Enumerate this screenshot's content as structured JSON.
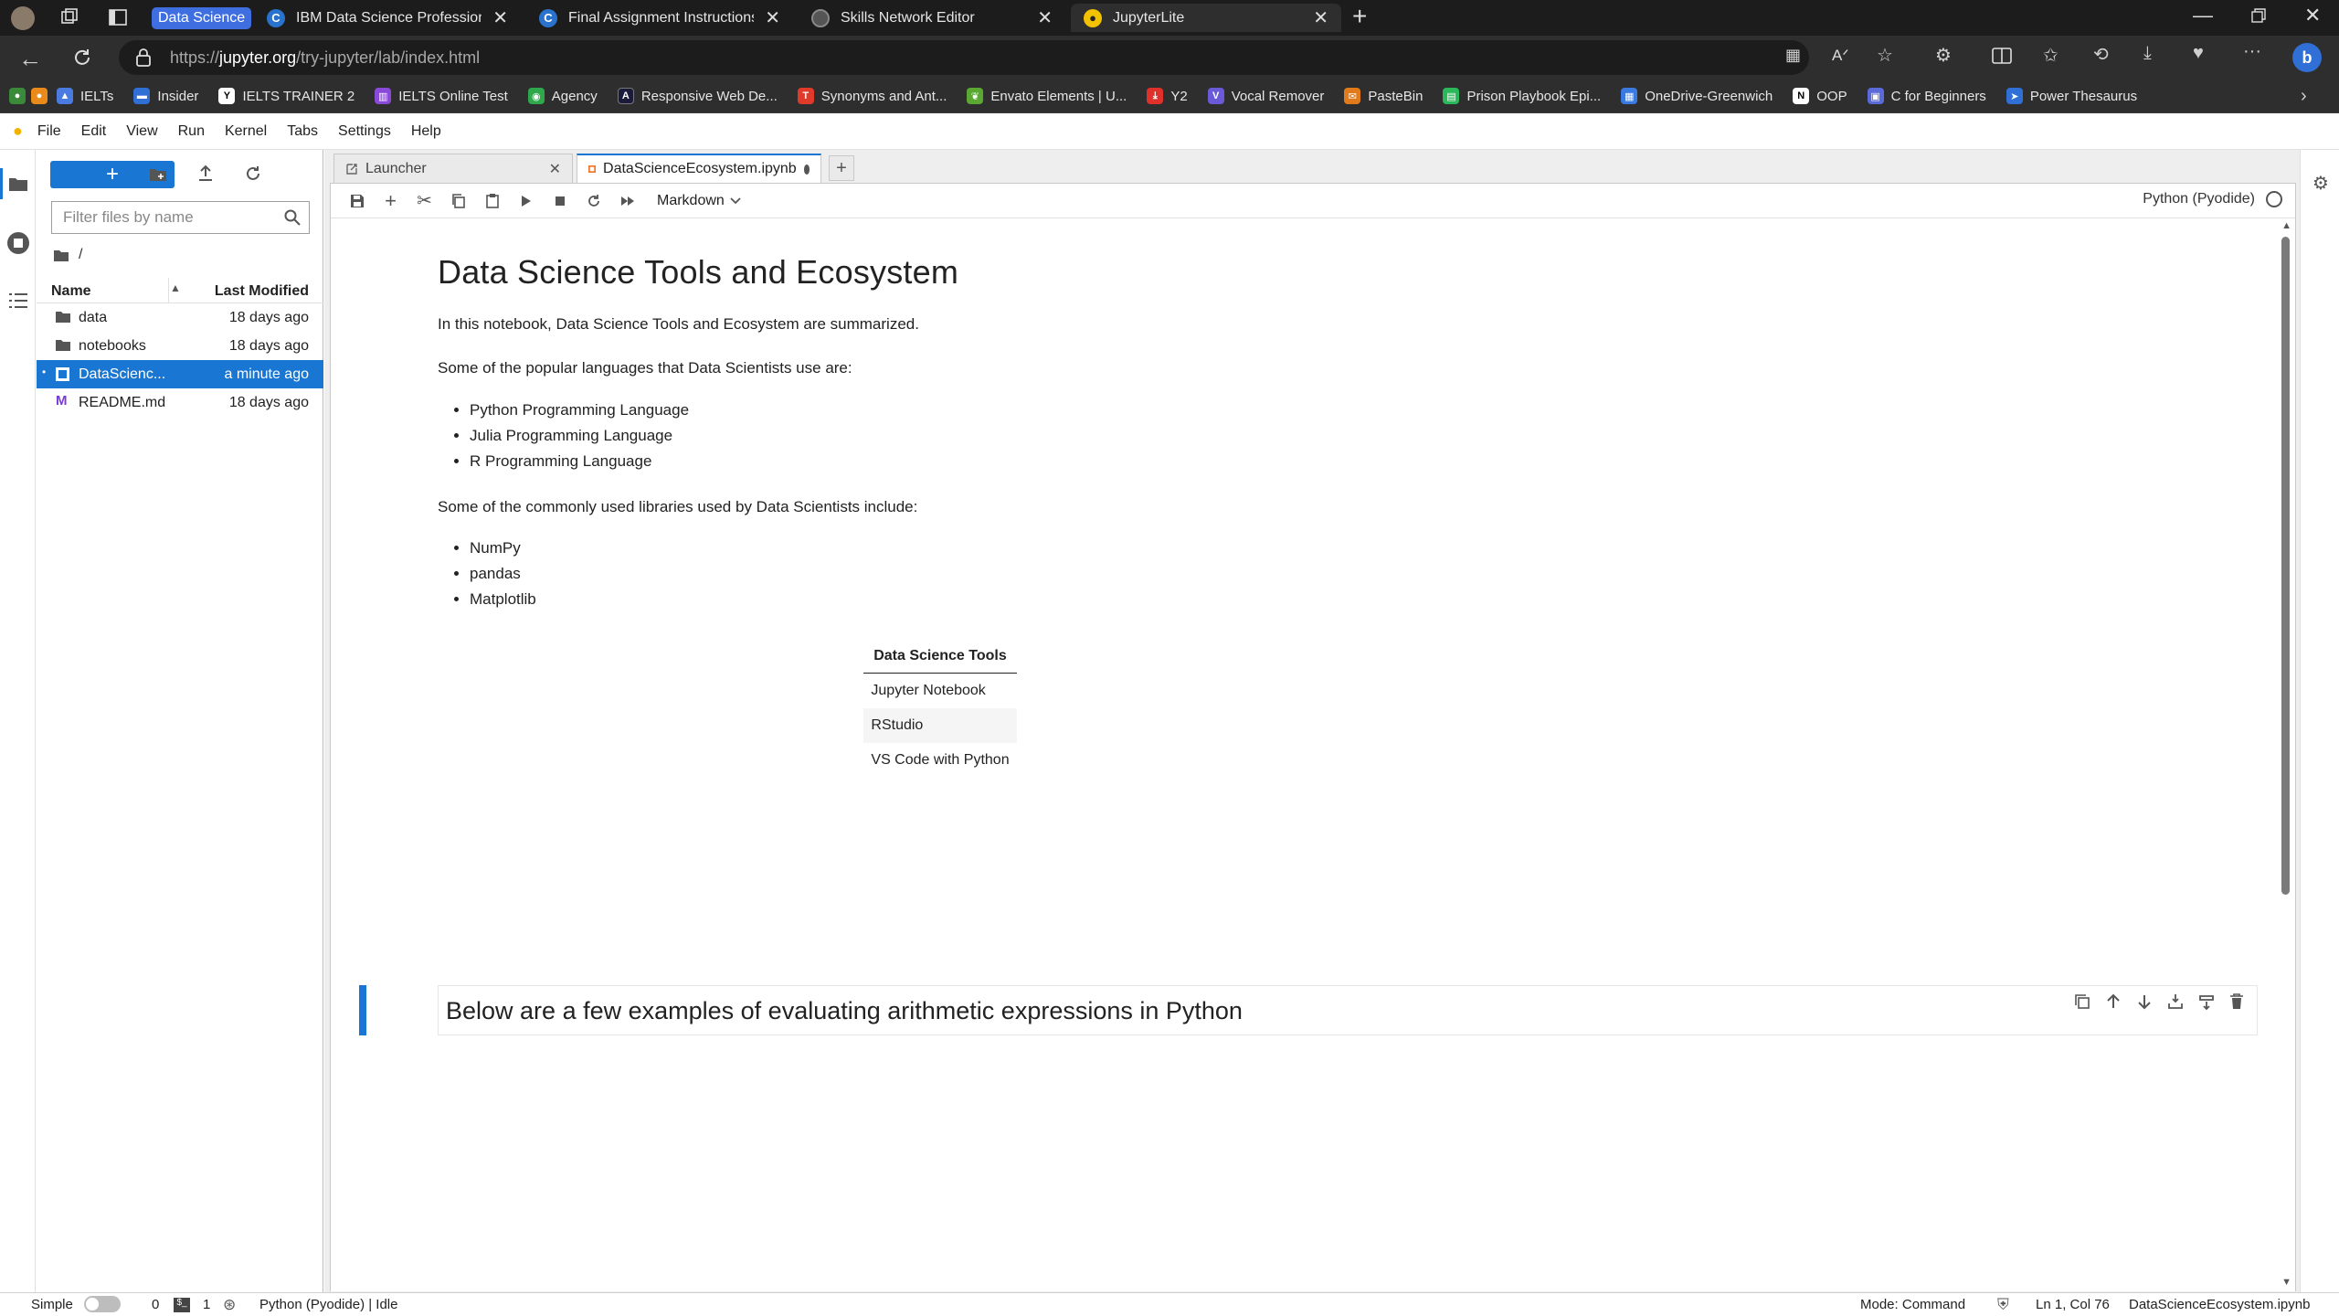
{
  "browser": {
    "tab_group": "Data Science",
    "tabs": [
      {
        "title": "IBM Data Science Professional C",
        "icon": "coursera-icon"
      },
      {
        "title": "Final Assignment Instructions: Cr",
        "icon": "coursera-icon"
      },
      {
        "title": "Skills Network Editor",
        "icon": "skills-network-icon"
      },
      {
        "title": "JupyterLite",
        "icon": "jupyter-icon"
      }
    ],
    "url_scheme": "https://",
    "url_host": "jupyter.org",
    "url_path": "/try-jupyter/lab/index.html",
    "bookmarks": [
      "IELTs",
      "Insider",
      "IELTS TRAINER 2",
      "IELTS Online Test",
      "Agency",
      "Responsive Web De...",
      "Synonyms and Ant...",
      "Envato Elements | U...",
      "Y2",
      "Vocal Remover",
      "PasteBin",
      "Prison Playbook Epi...",
      "OneDrive-Greenwich",
      "OOP",
      "C for Beginners",
      "Power Thesaurus"
    ]
  },
  "menu": [
    "File",
    "Edit",
    "View",
    "Run",
    "Kernel",
    "Tabs",
    "Settings",
    "Help"
  ],
  "filebrowser": {
    "filter_placeholder": "Filter files by name",
    "path": "/",
    "col_name": "Name",
    "col_modified": "Last Modified",
    "files": [
      {
        "name": "data",
        "modified": "18 days ago",
        "type": "folder"
      },
      {
        "name": "notebooks",
        "modified": "18 days ago",
        "type": "folder"
      },
      {
        "name": "DataScienc...",
        "modified": "a minute ago",
        "type": "notebook"
      },
      {
        "name": "README.md",
        "modified": "18 days ago",
        "type": "markdown"
      }
    ]
  },
  "dock": {
    "tab_launcher": "Launcher",
    "tab_notebook": "DataScienceEcosystem.ipynb",
    "cell_type": "Markdown",
    "kernel": "Python (Pyodide)"
  },
  "notebook": {
    "title": "Data Science Tools and Ecosystem",
    "intro": "In this notebook, Data Science Tools and Ecosystem are summarized.",
    "languages_intro": "Some of the popular languages that Data Scientists use are:",
    "languages": [
      "Python Programming Language",
      "Julia Programming Language",
      "R Programming Language"
    ],
    "libraries_intro": "Some of the commonly used libraries used by Data Scientists include:",
    "libraries": [
      "NumPy",
      "pandas",
      "Matplotlib"
    ],
    "table_header": "Data Science Tools",
    "tools": [
      "Jupyter Notebook",
      "RStudio",
      "VS Code with Python"
    ],
    "active_heading": "Below are a few examples of evaluating arithmetic expressions in Python"
  },
  "status": {
    "mode_label": "Simple",
    "count_a": "0",
    "count_b": "1",
    "kernel_status": "Python (Pyodide) | Idle",
    "mode": "Mode: Command",
    "position": "Ln 1, Col 76",
    "filename": "DataScienceEcosystem.ipynb"
  }
}
